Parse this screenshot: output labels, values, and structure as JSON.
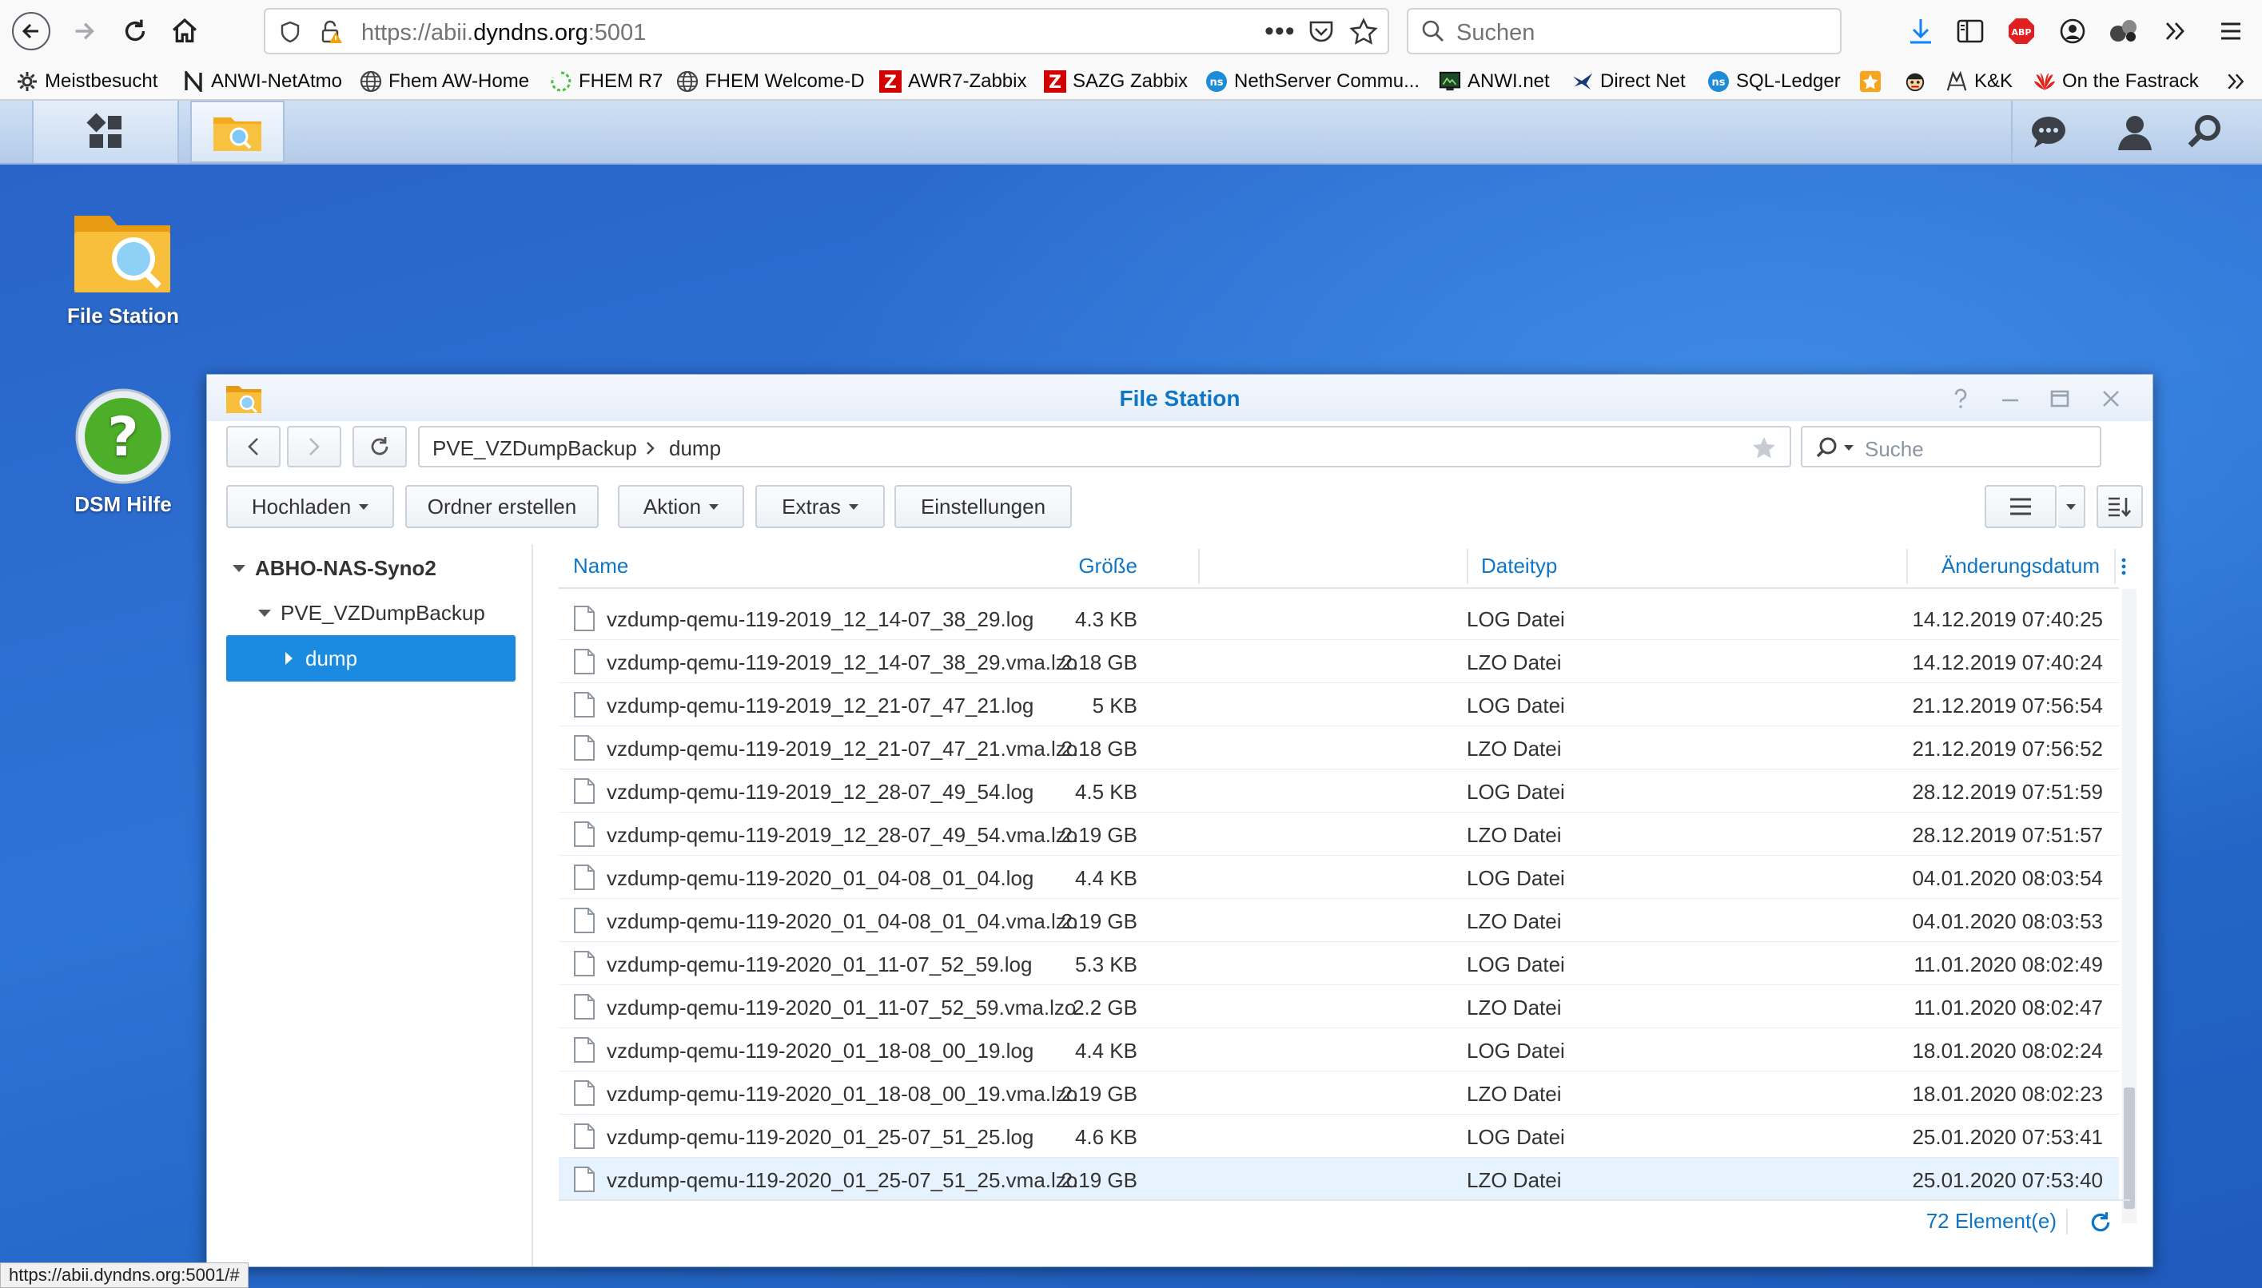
{
  "browser": {
    "url_prefix": "https://abii.",
    "url_host": "dyndns.org",
    "url_suffix": ":5001",
    "search_placeholder": "Suchen",
    "bookmarks": [
      {
        "label": "Meistbesucht",
        "icon": "gear-icon"
      },
      {
        "label": "ANWI-NetAtmo",
        "icon": "n-logo-icon"
      },
      {
        "label": "Fhem AW-Home",
        "icon": "globe-icon"
      },
      {
        "label": "FHEM R7",
        "icon": "spinner-icon"
      },
      {
        "label": "FHEM Welcome-D",
        "icon": "globe-icon"
      },
      {
        "label": "AWR7-Zabbix",
        "icon": "zabbix-icon"
      },
      {
        "label": "SAZG Zabbix",
        "icon": "zabbix-icon"
      },
      {
        "label": "NethServer Commu...",
        "icon": "nethserver-icon"
      },
      {
        "label": "ANWI.net",
        "icon": "monitor-icon"
      },
      {
        "label": "Direct Net",
        "icon": "bird-icon"
      },
      {
        "label": "SQL-Ledger",
        "icon": "nethserver-icon"
      },
      {
        "label": "",
        "icon": "orange-star-icon"
      },
      {
        "label": "",
        "icon": "face-icon"
      },
      {
        "label": "K&K",
        "icon": "kk-icon"
      },
      {
        "label": "On the Fastrack",
        "icon": "huawei-icon"
      }
    ],
    "status_url": "https://abii.dyndns.org:5001/#"
  },
  "desktop": {
    "icons": [
      {
        "label": "File Station"
      },
      {
        "label": "DSM Hilfe"
      }
    ]
  },
  "window": {
    "title": "File Station",
    "path": [
      "PVE_VZDumpBackup",
      "dump"
    ],
    "search_placeholder": "Suche",
    "actions": [
      {
        "label": "Hochladen",
        "dropdown": true
      },
      {
        "label": "Ordner erstellen",
        "dropdown": false
      },
      {
        "label": "Aktion",
        "dropdown": true
      },
      {
        "label": "Extras",
        "dropdown": true
      },
      {
        "label": "Einstellungen",
        "dropdown": false
      }
    ],
    "tree": {
      "root": "ABHO-NAS-Syno2",
      "child": "PVE_VZDumpBackup",
      "selected": "dump"
    },
    "columns": {
      "name": "Name",
      "size": "Größe",
      "type": "Dateityp",
      "date": "Änderungsdatum"
    },
    "files": [
      {
        "name": "vzdump-qemu-119-2019_12_14-07_38_29.log",
        "size": "4.3 KB",
        "type": "LOG Datei",
        "date": "14.12.2019 07:40:25"
      },
      {
        "name": "vzdump-qemu-119-2019_12_14-07_38_29.vma.lzo",
        "size": "2.18 GB",
        "type": "LZO Datei",
        "date": "14.12.2019 07:40:24"
      },
      {
        "name": "vzdump-qemu-119-2019_12_21-07_47_21.log",
        "size": "5 KB",
        "type": "LOG Datei",
        "date": "21.12.2019 07:56:54"
      },
      {
        "name": "vzdump-qemu-119-2019_12_21-07_47_21.vma.lzo",
        "size": "2.18 GB",
        "type": "LZO Datei",
        "date": "21.12.2019 07:56:52"
      },
      {
        "name": "vzdump-qemu-119-2019_12_28-07_49_54.log",
        "size": "4.5 KB",
        "type": "LOG Datei",
        "date": "28.12.2019 07:51:59"
      },
      {
        "name": "vzdump-qemu-119-2019_12_28-07_49_54.vma.lzo",
        "size": "2.19 GB",
        "type": "LZO Datei",
        "date": "28.12.2019 07:51:57"
      },
      {
        "name": "vzdump-qemu-119-2020_01_04-08_01_04.log",
        "size": "4.4 KB",
        "type": "LOG Datei",
        "date": "04.01.2020 08:03:54"
      },
      {
        "name": "vzdump-qemu-119-2020_01_04-08_01_04.vma.lzo",
        "size": "2.19 GB",
        "type": "LZO Datei",
        "date": "04.01.2020 08:03:53"
      },
      {
        "name": "vzdump-qemu-119-2020_01_11-07_52_59.log",
        "size": "5.3 KB",
        "type": "LOG Datei",
        "date": "11.01.2020 08:02:49"
      },
      {
        "name": "vzdump-qemu-119-2020_01_11-07_52_59.vma.lzo",
        "size": "2.2 GB",
        "type": "LZO Datei",
        "date": "11.01.2020 08:02:47"
      },
      {
        "name": "vzdump-qemu-119-2020_01_18-08_00_19.log",
        "size": "4.4 KB",
        "type": "LOG Datei",
        "date": "18.01.2020 08:02:24"
      },
      {
        "name": "vzdump-qemu-119-2020_01_18-08_00_19.vma.lzo",
        "size": "2.19 GB",
        "type": "LZO Datei",
        "date": "18.01.2020 08:02:23"
      },
      {
        "name": "vzdump-qemu-119-2020_01_25-07_51_25.log",
        "size": "4.6 KB",
        "type": "LOG Datei",
        "date": "25.01.2020 07:53:41"
      },
      {
        "name": "vzdump-qemu-119-2020_01_25-07_51_25.vma.lzo",
        "size": "2.19 GB",
        "type": "LZO Datei",
        "date": "25.01.2020 07:53:40",
        "selected": true
      }
    ],
    "item_count": "72 Element(e)"
  },
  "colors": {
    "accent": "#0f76c6",
    "selected_tree": "#1a8be0",
    "desktop_blue": "#2d6fce"
  }
}
